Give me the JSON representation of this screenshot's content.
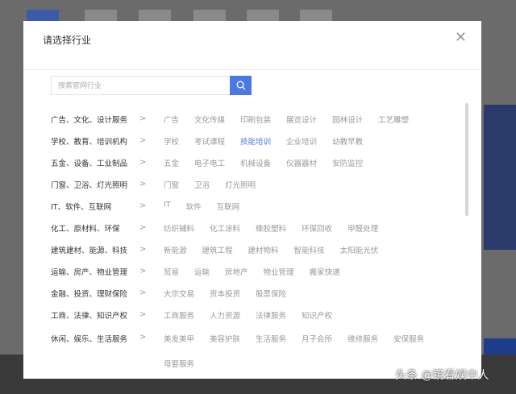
{
  "modal": {
    "title": "请选择行业",
    "close_icon": "close-icon",
    "search": {
      "placeholder": "搜索官网行业",
      "value": "",
      "icon": "search-icon"
    },
    "categories": [
      {
        "label": "广告、文化、设计服务",
        "subs": [
          "广告",
          "文化传媒",
          "印刷包装",
          "展览设计",
          "园林设计",
          "工艺雕塑"
        ]
      },
      {
        "label": "学校、教育、培训机构",
        "subs": [
          "学校",
          "考试课程",
          "技能培训",
          "企业培训",
          "幼教早教"
        ],
        "active": "技能培训"
      },
      {
        "label": "五金、设备、工业制品",
        "subs": [
          "五金",
          "电子电工",
          "机械设备",
          "仪器器材",
          "安防监控"
        ]
      },
      {
        "label": "门窗、卫浴、灯光照明",
        "subs": [
          "门窗",
          "卫浴",
          "灯光照明"
        ]
      },
      {
        "label": "IT、软件、互联网",
        "subs": [
          "IT",
          "软件",
          "互联网"
        ]
      },
      {
        "label": "化工、原材料、环保",
        "subs": [
          "纺织辅料",
          "化工涂料",
          "橡胶塑料",
          "环保回收",
          "甲醛处理"
        ]
      },
      {
        "label": "建筑建材、能源、科技",
        "subs": [
          "新能源",
          "建筑工程",
          "建材物料",
          "智能科技",
          "太阳能光伏"
        ]
      },
      {
        "label": "运输、房产、物业管理",
        "subs": [
          "贸易",
          "运输",
          "房地产",
          "物业管理",
          "搬家快递"
        ]
      },
      {
        "label": "金融、投资、理财保险",
        "subs": [
          "大宗交易",
          "资本投资",
          "股票保险"
        ]
      },
      {
        "label": "工商、法律、知识产权",
        "subs": [
          "工商服务",
          "人力资源",
          "法律服务",
          "知识产权"
        ]
      },
      {
        "label": "休闲、娱乐、生活服务",
        "subs": [
          "美发美甲",
          "美容护肤",
          "生活服务",
          "月子会所",
          "维修服务",
          "安保服务",
          "母婴服务"
        ]
      }
    ]
  },
  "watermark": "头条 @镜看娱中人"
}
